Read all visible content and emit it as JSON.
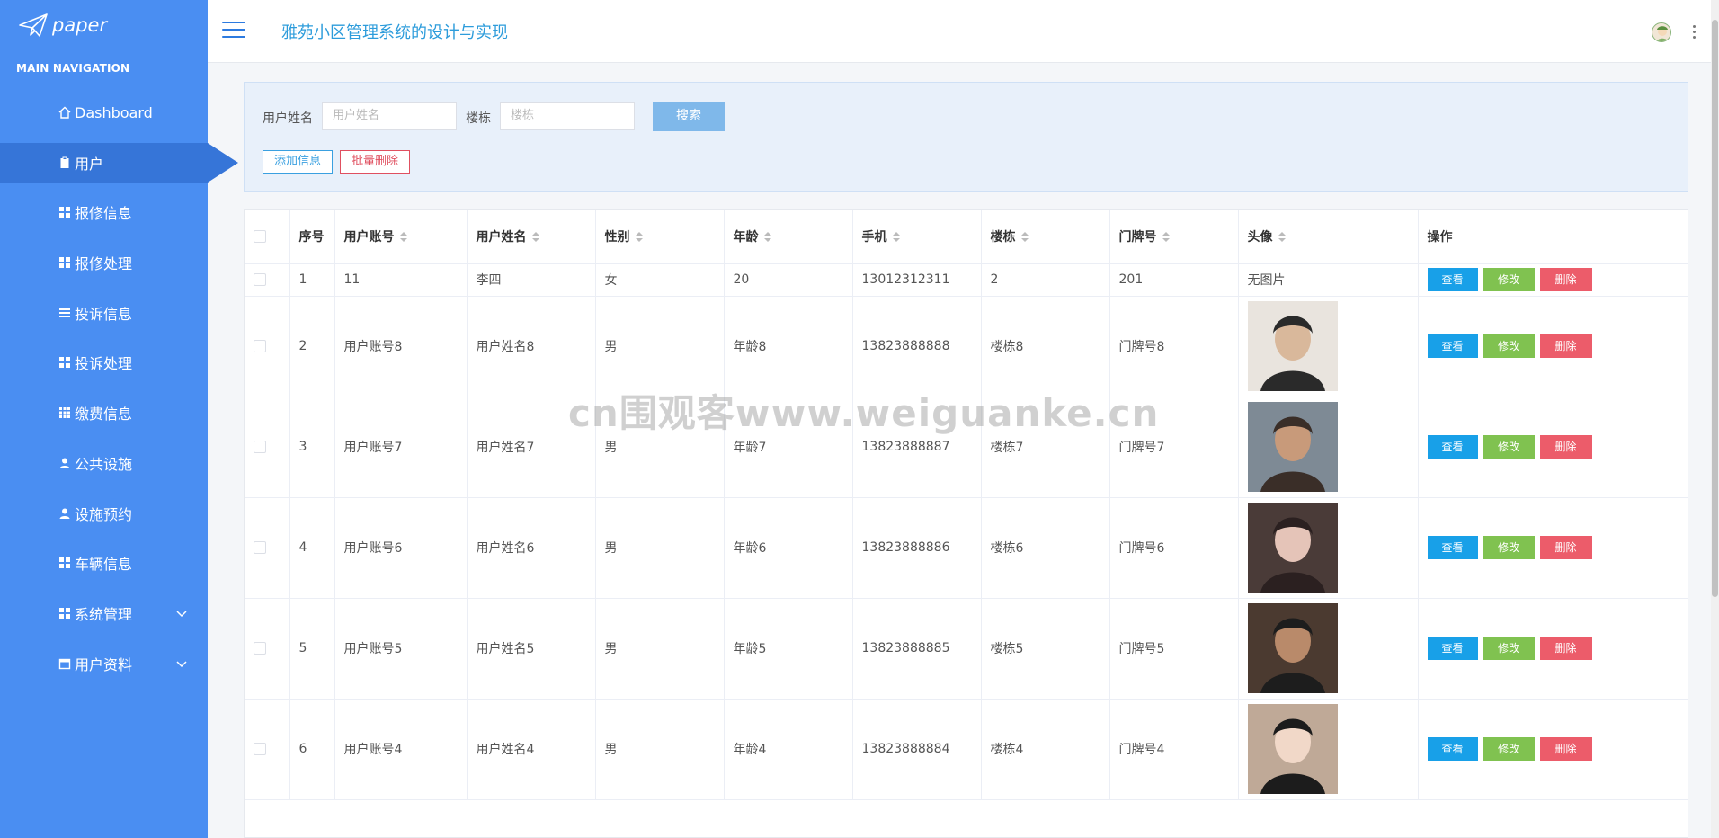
{
  "brand": {
    "text": "paper"
  },
  "sidebar": {
    "section_title": "MAIN NAVIGATION",
    "items": [
      {
        "label": "Dashboard",
        "icon": "home-icon"
      },
      {
        "label": "用户",
        "icon": "clipboard-icon",
        "active": true
      },
      {
        "label": "报修信息",
        "icon": "grid-icon"
      },
      {
        "label": "报修处理",
        "icon": "grid-icon"
      },
      {
        "label": "投诉信息",
        "icon": "list-icon"
      },
      {
        "label": "投诉处理",
        "icon": "grid-icon"
      },
      {
        "label": "缴费信息",
        "icon": "grid-icon"
      },
      {
        "label": "公共设施",
        "icon": "user-icon"
      },
      {
        "label": "设施预约",
        "icon": "user-icon"
      },
      {
        "label": "车辆信息",
        "icon": "grid-icon"
      },
      {
        "label": "系统管理",
        "icon": "grid-icon",
        "expandable": true
      },
      {
        "label": "用户资料",
        "icon": "calendar-icon",
        "expandable": true
      }
    ]
  },
  "header": {
    "title": "雅苑小区管理系统的设计与实现"
  },
  "search": {
    "name_label": "用户姓名",
    "name_placeholder": "用户姓名",
    "building_label": "楼栋",
    "building_placeholder": "楼栋",
    "search_button": "搜索",
    "add_button": "添加信息",
    "batch_delete_button": "批量删除"
  },
  "table": {
    "columns": [
      "序号",
      "用户账号",
      "用户姓名",
      "性别",
      "年龄",
      "手机",
      "楼栋",
      "门牌号",
      "头像",
      "操作"
    ],
    "actions": {
      "view": "查看",
      "edit": "修改",
      "delete": "删除"
    },
    "rows": [
      {
        "no": "1",
        "account": "11",
        "name": "李四",
        "gender": "女",
        "age": "20",
        "phone": "13012312311",
        "building": "2",
        "door": "201",
        "avatar": "无图片"
      },
      {
        "no": "2",
        "account": "用户账号8",
        "name": "用户姓名8",
        "gender": "男",
        "age": "年龄8",
        "phone": "13823888888",
        "building": "楼栋8",
        "door": "门牌号8",
        "avatar": ""
      },
      {
        "no": "3",
        "account": "用户账号7",
        "name": "用户姓名7",
        "gender": "男",
        "age": "年龄7",
        "phone": "13823888887",
        "building": "楼栋7",
        "door": "门牌号7",
        "avatar": ""
      },
      {
        "no": "4",
        "account": "用户账号6",
        "name": "用户姓名6",
        "gender": "男",
        "age": "年龄6",
        "phone": "13823888886",
        "building": "楼栋6",
        "door": "门牌号6",
        "avatar": ""
      },
      {
        "no": "5",
        "account": "用户账号5",
        "name": "用户姓名5",
        "gender": "男",
        "age": "年龄5",
        "phone": "13823888885",
        "building": "楼栋5",
        "door": "门牌号5",
        "avatar": ""
      },
      {
        "no": "6",
        "account": "用户账号4",
        "name": "用户姓名4",
        "gender": "男",
        "age": "年龄4",
        "phone": "13823888884",
        "building": "楼栋4",
        "door": "门牌号4",
        "avatar": ""
      }
    ]
  },
  "watermark": "cn围观客www.weiguanke.cn",
  "colors": {
    "sidebar": "#4a8ef2",
    "active": "#3675d8",
    "title": "#2d9cdb",
    "view": "#18a0e8",
    "edit": "#80c250",
    "delete": "#ec5c6a"
  }
}
